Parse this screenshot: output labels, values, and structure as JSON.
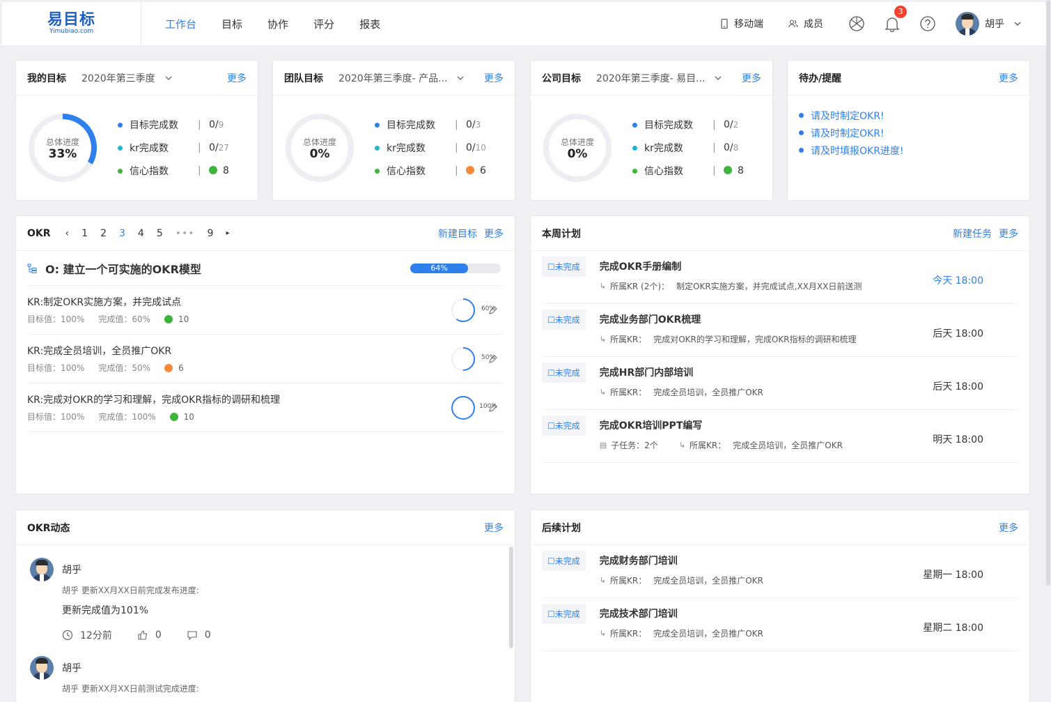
{
  "app": {
    "logo_cn": "易目标",
    "logo_en": "Yimubiao.com"
  },
  "nav": {
    "items": [
      {
        "label": "工作台",
        "active": true
      },
      {
        "label": "目标"
      },
      {
        "label": "协作"
      },
      {
        "label": "评分"
      },
      {
        "label": "报表"
      }
    ]
  },
  "topright": {
    "mobile": "移动端",
    "members": "成员",
    "notification_count": "3",
    "user_name": "胡乎"
  },
  "my_goal": {
    "title": "我的目标",
    "period": "2020年第三季度",
    "more": "更多",
    "ring_label": "总体进度",
    "progress_text": "33%",
    "progress": 0.33,
    "rows": [
      {
        "name": "目标完成数",
        "value": "0/",
        "total": "9",
        "dot": "#2f80ed"
      },
      {
        "name": "kr完成数",
        "value": "0/",
        "total": "27",
        "dot": "#1fb6d3"
      },
      {
        "name": "信心指数",
        "value": "8",
        "mood": "good",
        "dot": "#3fb43c"
      }
    ]
  },
  "team_goal": {
    "title": "团队目标",
    "period": "2020年第三季度- 产品...",
    "more": "更多",
    "ring_label": "总体进度",
    "progress_text": "0%",
    "progress": 0,
    "rows": [
      {
        "name": "目标完成数",
        "value": "0/",
        "total": "3",
        "dot": "#2f80ed"
      },
      {
        "name": "kr完成数",
        "value": "0/",
        "total": "10",
        "dot": "#1fb6d3"
      },
      {
        "name": "信心指数",
        "value": "6",
        "mood": "neutral",
        "dot": "#3fb43c"
      }
    ]
  },
  "company_goal": {
    "title": "公司目标",
    "period": "2020年第三季度- 易目...",
    "more": "更多",
    "ring_label": "总体进度",
    "progress_text": "0%",
    "progress": 0,
    "rows": [
      {
        "name": "目标完成数",
        "value": "0/",
        "total": "2",
        "dot": "#2f80ed"
      },
      {
        "name": "kr完成数",
        "value": "0/",
        "total": "8",
        "dot": "#1fb6d3"
      },
      {
        "name": "信心指数",
        "value": "8",
        "mood": "good",
        "dot": "#3fb43c"
      }
    ]
  },
  "todo": {
    "title": "待办/提醒",
    "more": "更多",
    "items": [
      "请及时制定OKR!",
      "请及时制定OKR!",
      "请及时填报OKR进度!"
    ]
  },
  "okr": {
    "title": "OKR",
    "pages": [
      "1",
      "2",
      "3",
      "4",
      "5",
      "•••",
      "9"
    ],
    "current_page": "3",
    "new_goal": "新建目标",
    "more": "更多",
    "objective": "O: 建立一个可实施的OKR模型",
    "objective_progress_text": "64%",
    "objective_progress": 0.64,
    "krs": [
      {
        "title": "KR:制定OKR实施方案，并完成试点",
        "target": "目标值：100%",
        "done": "完成值：60%",
        "mood": "good",
        "score": "10",
        "pct_text": "60%",
        "pct": 0.6
      },
      {
        "title": "KR:完成全员培训，全员推广OKR",
        "target": "目标值：100%",
        "done": "完成值：50%",
        "mood": "neutral",
        "score": "6",
        "pct_text": "50%",
        "pct": 0.5
      },
      {
        "title": "KR:完成对OKR的学习和理解，完成OKR指标的调研和梳理",
        "target": "目标值：100%",
        "done": "完成值：100%",
        "mood": "good",
        "score": "10",
        "pct_text": "100%",
        "pct": 1.0
      }
    ]
  },
  "week_plan": {
    "title": "本周计划",
    "new_task": "新建任务",
    "more": "更多",
    "tasks": [
      {
        "tag": "☐未完成",
        "title": "完成OKR手册编制",
        "kr_label": "所属KR (2个)：",
        "kr": "制定OKR实施方案，并完成试点,XX月XX日前送测",
        "time": "今天 18:00",
        "today": true
      },
      {
        "tag": "☐未完成",
        "title": "完成业务部门OKR梳理",
        "kr_label": "所属KR：",
        "kr": "完成对OKR的学习和理解，完成OKR指标的调研和梳理",
        "time": "后天 18:00"
      },
      {
        "tag": "☐未完成",
        "title": "完成HR部门内部培训",
        "kr_label": "所属KR：",
        "kr": "完成全员培训，全员推广OKR",
        "time": "后天 18:00"
      },
      {
        "tag": "☐未完成",
        "title": "完成OKR培训PPT编写",
        "sub_label": "子任务：2个",
        "kr_label": "所属KR：",
        "kr": "完成全员培训，全员推广OKR",
        "time": "明天 18:00"
      }
    ]
  },
  "okr_feed": {
    "title": "OKR动态",
    "more": "更多",
    "items": [
      {
        "user": "胡乎",
        "desc": "胡乎 更新XX月XX日前完成发布进度:",
        "text": "更新完成值为101%",
        "time": "12分前",
        "likes": "0",
        "comments": "0"
      },
      {
        "user": "胡乎",
        "desc": "胡乎 更新XX月XX日前测试完成进度:"
      }
    ]
  },
  "later_plan": {
    "title": "后续计划",
    "more": "更多",
    "tasks": [
      {
        "tag": "☐未完成",
        "title": "完成财务部门培训",
        "kr_label": "所属KR：",
        "kr": "完成全员培训，全员推广OKR",
        "time": "星期一 18:00"
      },
      {
        "tag": "☐未完成",
        "title": "完成技术部门培训",
        "kr_label": "所属KR：",
        "kr": "完成全员培训，全员推广OKR",
        "time": "星期二 18:00"
      }
    ]
  },
  "colors": {
    "accent": "#2f80ed",
    "good": "#3fb43c",
    "neutral": "#f38a3a",
    "badge": "#f5422f"
  }
}
